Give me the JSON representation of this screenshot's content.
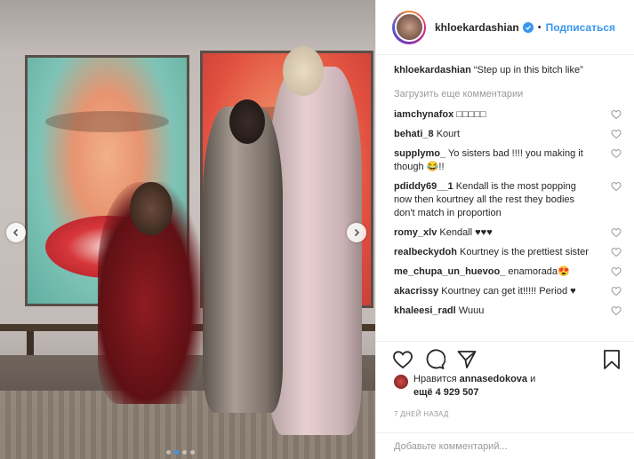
{
  "post": {
    "username": "khloekardashian",
    "follow_label": "Подписаться",
    "bullet": "•",
    "caption_user": "khloekardashian",
    "caption_text": "“Step up in this bitch like”",
    "load_more": "Загрузить еще комментарии",
    "comments": [
      {
        "user": "iamchynafox",
        "text": "□□□□□"
      },
      {
        "user": "behati_8",
        "text": "Kourt"
      },
      {
        "user": "supplymo_",
        "text": "Yo sisters bad !!!! you making it though 😂!!"
      },
      {
        "user": "pdiddy69__1",
        "text": "Kendall is the most popping now then kourtney all the rest they bodies don't match in proportion"
      },
      {
        "user": "romy_xlv",
        "text": "Kendall ♥♥♥"
      },
      {
        "user": "realbeckydoh",
        "text": "Kourtney is the prettiest sister"
      },
      {
        "user": "me_chupa_un_huevoo_",
        "text": "enamorada😍"
      },
      {
        "user": "akacrissy",
        "text": "Kourtney can get it!!!!! Period ♥"
      },
      {
        "user": "khaleesi_radl",
        "text": "Wuuu"
      }
    ],
    "likes_prefix": "Нравится",
    "likes_user": "annasedokova",
    "likes_and": "и",
    "likes_more": "ещё 4 929 507",
    "time": "7 ДНЕЙ НАЗАД",
    "add_comment_placeholder": "Добавьте комментарий..."
  },
  "carousel": {
    "slides": 4,
    "active": 1
  },
  "icons": {
    "verified": "verified-badge-icon",
    "like": "heart-icon",
    "comment": "comment-icon",
    "share": "share-icon",
    "save": "bookmark-icon"
  },
  "colors": {
    "accent": "#3897f0",
    "text": "#262626",
    "muted": "#999999"
  }
}
